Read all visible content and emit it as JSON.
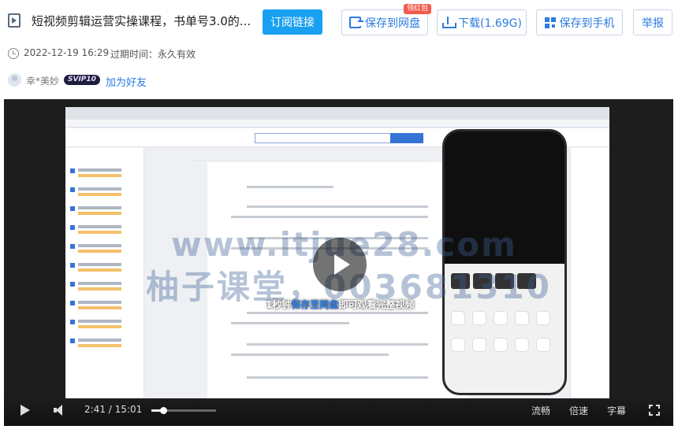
{
  "header": {
    "title": "短视频剪辑运营实操课程，书单号3.0的...",
    "subscribe_label": "订阅链接",
    "save_to_disk_label": "保存到网盘",
    "red_packet_badge": "领红包",
    "download_label": "下载(1.69G)",
    "save_to_phone_label": "保存到手机",
    "report_label": "举报"
  },
  "meta": {
    "date": "2022-12-19 16:29",
    "expire_label": "过期时间：",
    "expire_value": "永久有效",
    "username": "幸*美妙",
    "vip_badge": "SVIP10",
    "add_friend_label": "加为好友"
  },
  "player": {
    "watermark_line1": "www.itjue28.com",
    "watermark_line2": "柚子课堂，003681310",
    "cta_prefix": "1秒钟",
    "cta_link": "保存至网盘",
    "cta_suffix": "即可观看完整视频",
    "current_time": "2:41",
    "duration": "15:01",
    "time_separator": "/",
    "progress_fraction": 0.1787,
    "smooth_label": "流畅",
    "speed_label": "倍速",
    "subtitle_label": "字幕"
  },
  "colors": {
    "accent": "#1aa0f0",
    "link": "#2b7be0",
    "red_badge": "#f25b4c"
  }
}
